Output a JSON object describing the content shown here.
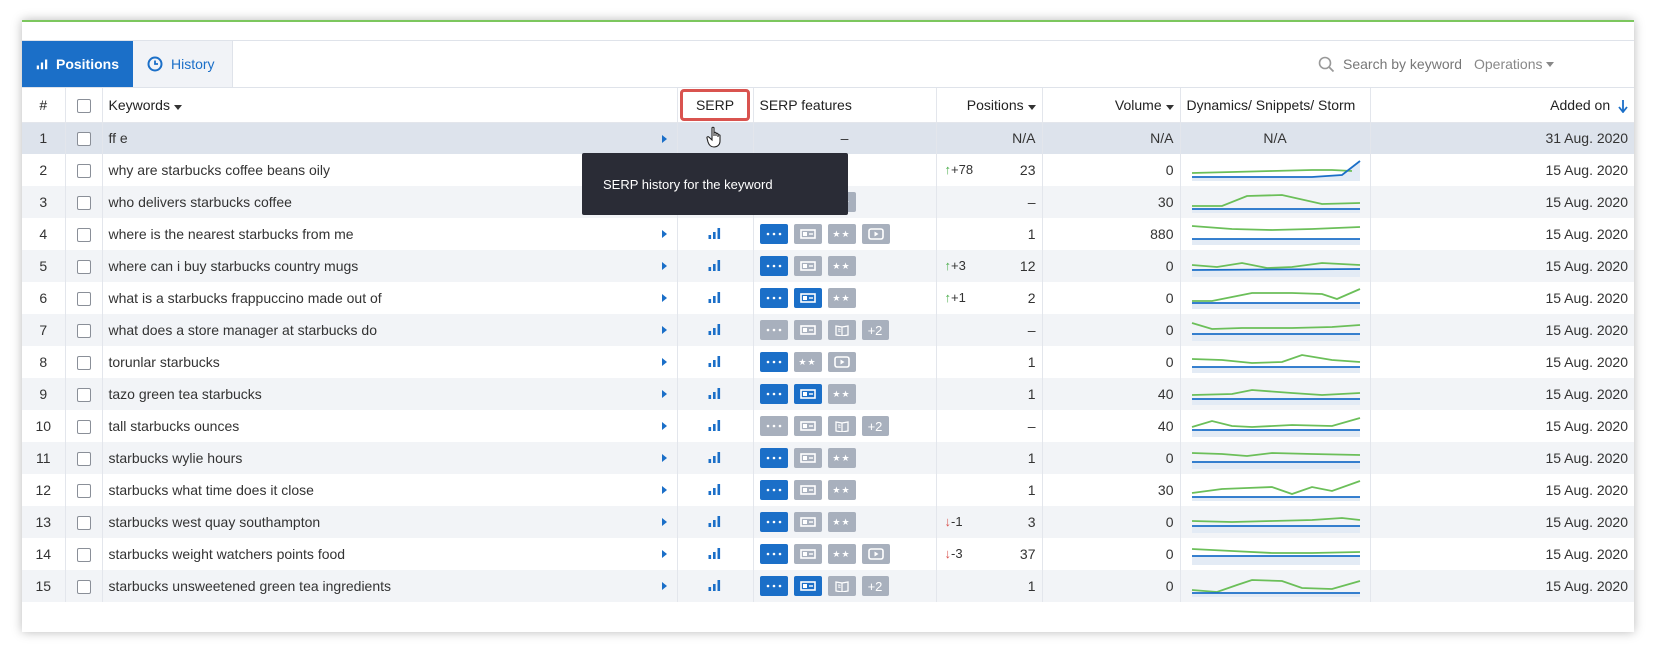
{
  "tabs": [
    {
      "label": "Positions",
      "icon": "bar-chart-icon",
      "active": true
    },
    {
      "label": "History",
      "icon": "clock-icon",
      "active": false
    }
  ],
  "search": {
    "placeholder": "Search by keywords"
  },
  "operations_label": "Operations",
  "columns": {
    "num": "#",
    "keywords": "Keywords",
    "serp": "SERP",
    "serp_features": "SERP features",
    "positions": "Positions",
    "volume": "Volume",
    "dynamics": "Dynamics/ Snippets/ Storm",
    "added_on": "Added on"
  },
  "tooltip": "SERP history for the keyword",
  "colors": {
    "accent": "#1b6fc8",
    "up": "#4cae4c",
    "down": "#d9534f",
    "spark_green": "#6bbf59",
    "spark_blue": "#1b6fc8"
  },
  "rows": [
    {
      "n": "1",
      "kw": "ff e",
      "features": [],
      "feat_text": "–",
      "change": "",
      "dir": "",
      "pos": "N/A",
      "vol": "N/A",
      "dyn_text": "N/A",
      "added": "31 Aug. 2020"
    },
    {
      "n": "2",
      "kw": "why are starbucks coffee beans oily",
      "features": [],
      "feat_text": "",
      "change": "+78",
      "dir": "up",
      "pos": "23",
      "vol": "0",
      "added": "15 Aug. 2020"
    },
    {
      "n": "3",
      "kw": "who delivers starbucks coffee",
      "features": [
        "grey-dots",
        "grey-r",
        "grey-stars"
      ],
      "change": "",
      "dir": "",
      "pos": "–",
      "vol": "30",
      "added": "15 Aug. 2020"
    },
    {
      "n": "4",
      "kw": "where is the nearest starbucks from me",
      "features": [
        "blue-dots",
        "grey-r",
        "grey-stars",
        "grey-play"
      ],
      "change": "",
      "dir": "",
      "pos": "1",
      "vol": "880",
      "added": "15 Aug. 2020"
    },
    {
      "n": "5",
      "kw": "where can i buy starbucks country mugs",
      "features": [
        "blue-dots",
        "grey-r",
        "grey-stars"
      ],
      "change": "+3",
      "dir": "up",
      "pos": "12",
      "vol": "0",
      "added": "15 Aug. 2020"
    },
    {
      "n": "6",
      "kw": "what is a starbucks frappuccino made out of",
      "features": [
        "blue-dots",
        "blue-r",
        "grey-stars"
      ],
      "change": "+1",
      "dir": "up",
      "pos": "2",
      "vol": "0",
      "added": "15 Aug. 2020"
    },
    {
      "n": "7",
      "kw": "what does a store manager at starbucks do",
      "features": [
        "grey-dots",
        "grey-r",
        "grey-book",
        "more"
      ],
      "more": "+2",
      "change": "",
      "dir": "",
      "pos": "–",
      "vol": "0",
      "added": "15 Aug. 2020"
    },
    {
      "n": "8",
      "kw": "torunlar starbucks",
      "features": [
        "blue-dots",
        "grey-stars",
        "grey-play"
      ],
      "change": "",
      "dir": "",
      "pos": "1",
      "vol": "0",
      "added": "15 Aug. 2020"
    },
    {
      "n": "9",
      "kw": "tazo green tea starbucks",
      "features": [
        "blue-dots",
        "blue-r",
        "grey-stars"
      ],
      "change": "",
      "dir": "",
      "pos": "1",
      "vol": "40",
      "added": "15 Aug. 2020"
    },
    {
      "n": "10",
      "kw": "tall starbucks ounces",
      "features": [
        "grey-dots",
        "grey-r",
        "grey-book",
        "more"
      ],
      "more": "+2",
      "change": "",
      "dir": "",
      "pos": "–",
      "vol": "40",
      "added": "15 Aug. 2020"
    },
    {
      "n": "11",
      "kw": "starbucks wylie hours",
      "features": [
        "blue-dots",
        "grey-r",
        "grey-stars"
      ],
      "change": "",
      "dir": "",
      "pos": "1",
      "vol": "0",
      "added": "15 Aug. 2020"
    },
    {
      "n": "12",
      "kw": "starbucks what time does it close",
      "features": [
        "blue-dots",
        "grey-r",
        "grey-stars"
      ],
      "change": "",
      "dir": "",
      "pos": "1",
      "vol": "30",
      "added": "15 Aug. 2020"
    },
    {
      "n": "13",
      "kw": "starbucks west quay southampton",
      "features": [
        "blue-dots",
        "grey-r",
        "grey-stars"
      ],
      "change": "-1",
      "dir": "down",
      "pos": "3",
      "vol": "0",
      "added": "15 Aug. 2020"
    },
    {
      "n": "14",
      "kw": "starbucks weight watchers points food",
      "features": [
        "blue-dots",
        "grey-r",
        "grey-stars",
        "grey-play"
      ],
      "change": "-3",
      "dir": "down",
      "pos": "37",
      "vol": "0",
      "added": "15 Aug. 2020"
    },
    {
      "n": "15",
      "kw": "starbucks unsweetened green tea ingredients",
      "features": [
        "blue-dots",
        "blue-r",
        "grey-book",
        "more"
      ],
      "more": "+2",
      "change": "",
      "dir": "",
      "pos": "1",
      "vol": "0",
      "added": "15 Aug. 2020"
    }
  ]
}
